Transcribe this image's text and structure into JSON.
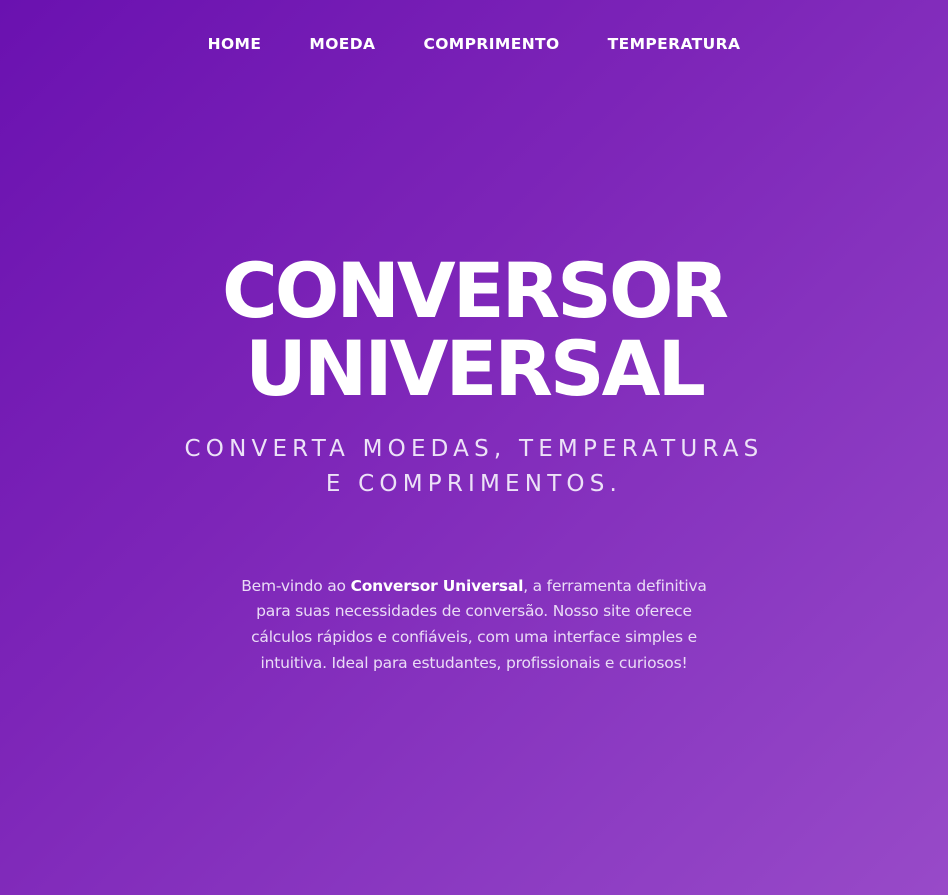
{
  "nav": {
    "items": [
      {
        "label": "HOME"
      },
      {
        "label": "MOEDA"
      },
      {
        "label": "COMPRIMENTO"
      },
      {
        "label": "TEMPERATURA"
      }
    ]
  },
  "hero": {
    "title_line1": "CONVERSOR",
    "title_line2": "UNIVERSAL",
    "subtitle": "Converta moedas, temperaturas e comprimentos."
  },
  "intro": {
    "prefix": "Bem-vindo ao ",
    "brand": "Conversor Universal",
    "suffix": ", a ferramenta definitiva para suas necessidades de conversão. Nosso site oferece cálculos rápidos e confiáveis, com uma interface simples e intuitiva. Ideal para estudantes, profissionais e curiosos!"
  },
  "theme": {
    "gradient_start": "#6a11b0",
    "gradient_end": "#984ac8",
    "text": "#ffffff"
  }
}
